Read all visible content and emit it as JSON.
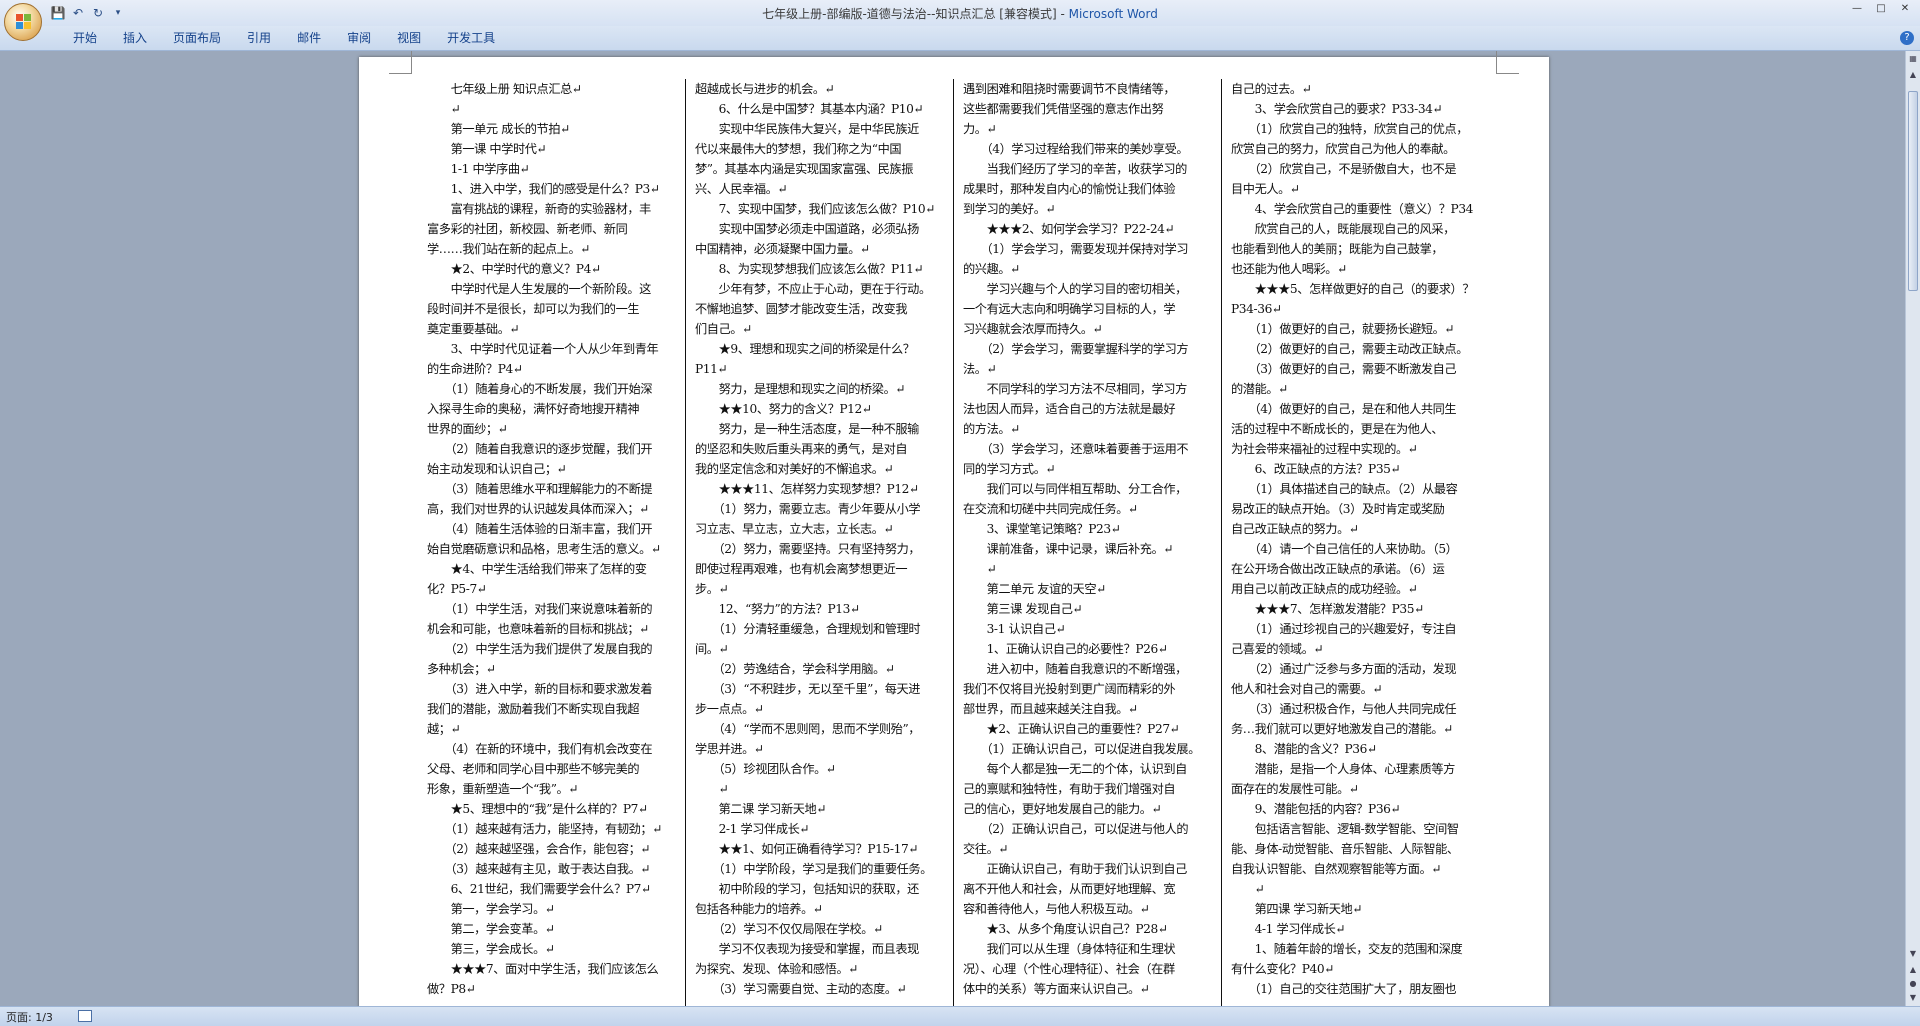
{
  "window": {
    "title_doc": "七年级上册-部编版-道德与法治--知识点汇总 [兼容模式] - ",
    "title_app": "Microsoft Word"
  },
  "ribbon": {
    "tabs": [
      "开始",
      "插入",
      "页面布局",
      "引用",
      "邮件",
      "审阅",
      "视图",
      "开发工具"
    ]
  },
  "status": {
    "page": "页面: 1/3"
  },
  "columns": [
    [
      "　　七年级上册 知识点汇总↵",
      "　　↵",
      "　　第一单元 成长的节拍↵",
      "　　第一课 中学时代↵",
      "　　1-1 中学序曲↵",
      "　　1、进入中学，我们的感受是什么？P3↵",
      "　　富有挑战的课程，新奇的实验器材，丰",
      "富多彩的社团，新校园、新老师、新同",
      "学……我们站在新的起点上。↵",
      "　　★2、中学时代的意义？P4↵",
      "　　中学时代是人生发展的一个新阶段。这",
      "段时间并不是很长，却可以为我们的一生",
      "奠定重要基础。↵",
      "　　3、中学时代见证着一个人从少年到青年",
      "的生命进阶？P4↵",
      "　　（1）随着身心的不断发展，我们开始深",
      "入探寻生命的奥秘，满怀好奇地搜开精神",
      "世界的面纱；↵",
      "　　（2）随着自我意识的逐步觉醒，我们开",
      "始主动发现和认识自己；↵",
      "　　（3）随着思维水平和理解能力的不断提",
      "高，我们对世界的认识越发具体而深入；↵",
      "　　（4）随着生活体验的日渐丰富，我们开",
      "始自觉磨砺意识和品格，思考生活的意义。↵",
      "　　★4、中学生活给我们带来了怎样的变",
      "化？P5-7↵",
      "　　（1）中学生活，对我们来说意味着新的",
      "机会和可能，也意味着新的目标和挑战；↵",
      "　　（2）中学生活为我们提供了发展自我的",
      "多种机会；↵",
      "　　（3）进入中学，新的目标和要求激发着",
      "我们的潜能，激励着我们不断实现自我超",
      "越；↵",
      "　　（4）在新的环境中，我们有机会改变在",
      "父母、老师和同学心目中那些不够完美的",
      "形象，重新塑造一个“我”。↵",
      "　　★5、理想中的“我”是什么样的？P7↵",
      "　　（1）越来越有活力，能坚持，有韧劲；↵",
      "　　（2）越来越坚强，会合作，能包容；↵",
      "　　（3）越来越有主见，敢于表达自我。↵",
      "　　6、21世纪，我们需要学会什么？P7↵",
      "　　第一，学会学习。↵",
      "　　第二，学会变革。↵",
      "　　第三，学会成长。↵",
      "　　★★★7、面对中学生活，我们应该怎么",
      "做？P8↵"
    ],
    [
      "超越成长与进步的机会。↵",
      "　　6、什么是中国梦？其基本内涵？P10↵",
      "　　实现中华民族伟大复兴，是中华民族近",
      "代以来最伟大的梦想，我们称之为“中国",
      "梦”。其基本内涵是实现国家富强、民族振",
      "兴、人民幸福。↵",
      "　　7、实现中国梦，我们应该怎么做？P10↵",
      "　　实现中国梦必须走中国道路，必须弘扬",
      "中国精神，必须凝聚中国力量。↵",
      "　　8、为实现梦想我们应该怎么做？P11↵",
      "　　少年有梦，不应止于心动，更在于行动。",
      "不懈地追梦、圆梦才能改变生活，改变我",
      "们自己。↵",
      "　　★9、理想和现实之间的桥梁是什么？",
      "P11↵",
      "　　努力，是理想和现实之间的桥梁。↵",
      "　　★★10、努力的含义？P12↵",
      "　　努力，是一种生活态度，是一种不服输",
      "的坚忍和失败后重头再来的勇气，是对自",
      "我的坚定信念和对美好的不懈追求。↵",
      "　　★★★11、怎样努力实现梦想？P12↵",
      "　　（1）努力，需要立志。青少年要从小学",
      "习立志、早立志，立大志，立长志。↵",
      "　　（2）努力，需要坚持。只有坚持努力，",
      "即使过程再艰难，也有机会离梦想更近一",
      "步。↵",
      "　　12、“努力”的方法？P13↵",
      "　　（1）分清轻重缓急，合理规划和管理时",
      "间。↵",
      "　　（2）劳逸结合，学会科学用脑。↵",
      "　　（3）“不积跬步，无以至千里”，每天进",
      "步一点点。↵",
      "　　（4）“学而不思则罔，思而不学则殆”，",
      "学思并进。↵",
      "　　（5）珍视团队合作。↵",
      "　　↵",
      "　　第二课 学习新天地↵",
      "　　2-1 学习伴成长↵",
      "　　★★1、如何正确看待学习？P15-17↵",
      "　　（1）中学阶段，学习是我们的重要任务。",
      "　　初中阶段的学习，包括知识的获取，还",
      "包括各种能力的培养。↵",
      "　　（2）学习不仅仅局限在学校。↵",
      "　　学习不仅表现为接受和掌握，而且表现",
      "为探究、发现、体验和感悟。↵",
      "　　（3）学习需要自觉、主动的态度。↵"
    ],
    [
      "遇到困难和阻挠时需要调节不良情绪等，",
      "这些都需要我们凭借坚强的意志作出努",
      "力。↵",
      "　　（4）学习过程给我们带来的美妙享受。",
      "　　当我们经历了学习的辛苦，收获学习的",
      "成果时，那种发自内心的愉悦让我们体验",
      "到学习的美好。↵",
      "　　★★★2、如何学会学习？P22-24↵",
      "　　（1）学会学习，需要发现并保持对学习",
      "的兴趣。↵",
      "　　学习兴趣与个人的学习目的密切相关，",
      "一个有远大志向和明确学习目标的人，学",
      "习兴趣就会浓厚而持久。↵",
      "　　（2）学会学习，需要掌握科学的学习方",
      "法。↵",
      "　　不同学科的学习方法不尽相同，学习方",
      "法也因人而异，适合自己的方法就是最好",
      "的方法。↵",
      "　　（3）学会学习，还意味着要善于运用不",
      "同的学习方式。↵",
      "　　我们可以与同伴相互帮助、分工合作，",
      "在交流和切磋中共同完成任务。↵",
      "　　3、课堂笔记策略？P23↵",
      "　　课前准备，课中记录，课后补充。↵",
      "　　↵",
      "　　第二单元 友谊的天空↵",
      "　　第三课 发现自己↵",
      "　　3-1 认识自己↵",
      "　　1、正确认识自己的必要性？P26↵",
      "　　进入初中，随着自我意识的不断增强，",
      "我们不仅将目光投射到更广阔而精彩的外",
      "部世界，而且越来越关注自我。↵",
      "　　★2、正确认识自己的重要性？P27↵",
      "　　（1）正确认识自己，可以促进自我发展。",
      "　　每个人都是独一无二的个体，认识到自",
      "己的禀赋和独特性，有助于我们增强对自",
      "己的信心，更好地发展自己的能力。↵",
      "　　（2）正确认识自己，可以促进与他人的",
      "交往。↵",
      "　　正确认识自己，有助于我们认识到自己",
      "离不开他人和社会，从而更好地理解、宽",
      "容和善待他人，与他人积极互动。↵",
      "　　★3、从多个角度认识自己？P28↵",
      "　　我们可以从生理（身体特征和生理状",
      "况）、心理（个性心理特征）、社会（在群",
      "体中的关系）等方面来认识自己。↵"
    ],
    [
      "自己的过去。↵",
      "　　3、学会欣赏自己的要求？P33-34↵",
      "　　（1）欣赏自己的独特，欣赏自己的优点，",
      "欣赏自己的努力，欣赏自己为他人的奉献。",
      "　　（2）欣赏自己，不是骄傲自大，也不是",
      "目中无人。↵",
      "　　4、学会欣赏自己的重要性（意义）？P34",
      "　　欣赏自己的人，既能展现自己的风采，",
      "也能看到他人的美丽；既能为自己鼓掌，",
      "也还能为他人喝彩。↵",
      "　　★★★5、怎样做更好的自己（的要求）？",
      "P34-36↵",
      "　　（1）做更好的自己，就要扬长避短。↵",
      "　　（2）做更好的自己，需要主动改正缺点。",
      "　　（3）做更好的自己，需要不断激发自己",
      "的潜能。↵",
      "　　（4）做更好的自己，是在和他人共同生",
      "活的过程中不断成长的，更是在为他人、",
      "为社会带来福祉的过程中实现的。↵",
      "　　6、改正缺点的方法？P35↵",
      "　　（1）具体描述自己的缺点。（2）从最容",
      "易改正的缺点开始。（3）及时肯定或奖励",
      "自己改正缺点的努力。↵",
      "　　（4）请一个自己信任的人来协助。（5）",
      "在公开场合做出改正缺点的承诺。（6）运",
      "用自己以前改正缺点的成功经验。↵",
      "　　★★★7、怎样激发潜能？P35↵",
      "　　（1）通过珍视自己的兴趣爱好，专注自",
      "己喜爱的领域。↵",
      "　　（2）通过广泛参与多方面的活动，发现",
      "他人和社会对自己的需要。↵",
      "　　（3）通过积极合作，与他人共同完成任",
      "务…我们就可以更好地激发自己的潜能。↵",
      "　　8、潜能的含义？P36↵",
      "　　潜能，是指一个人身体、心理素质等方",
      "面存在的发展性可能。↵",
      "　　9、潜能包括的内容？P36↵",
      "　　包括语言智能、逻辑-数学智能、空间智",
      "能、身体-动觉智能、音乐智能、人际智能、",
      "自我认识智能、自然观察智能等方面。↵",
      "　　↵",
      "　　第四课 学习新天地↵",
      "　　4-1 学习伴成长↵",
      "　　1、随着年龄的增长，交友的范围和深度",
      "有什么变化？P40↵",
      "　　（1）自己的交往范围扩大了，朋友圈也"
    ]
  ]
}
